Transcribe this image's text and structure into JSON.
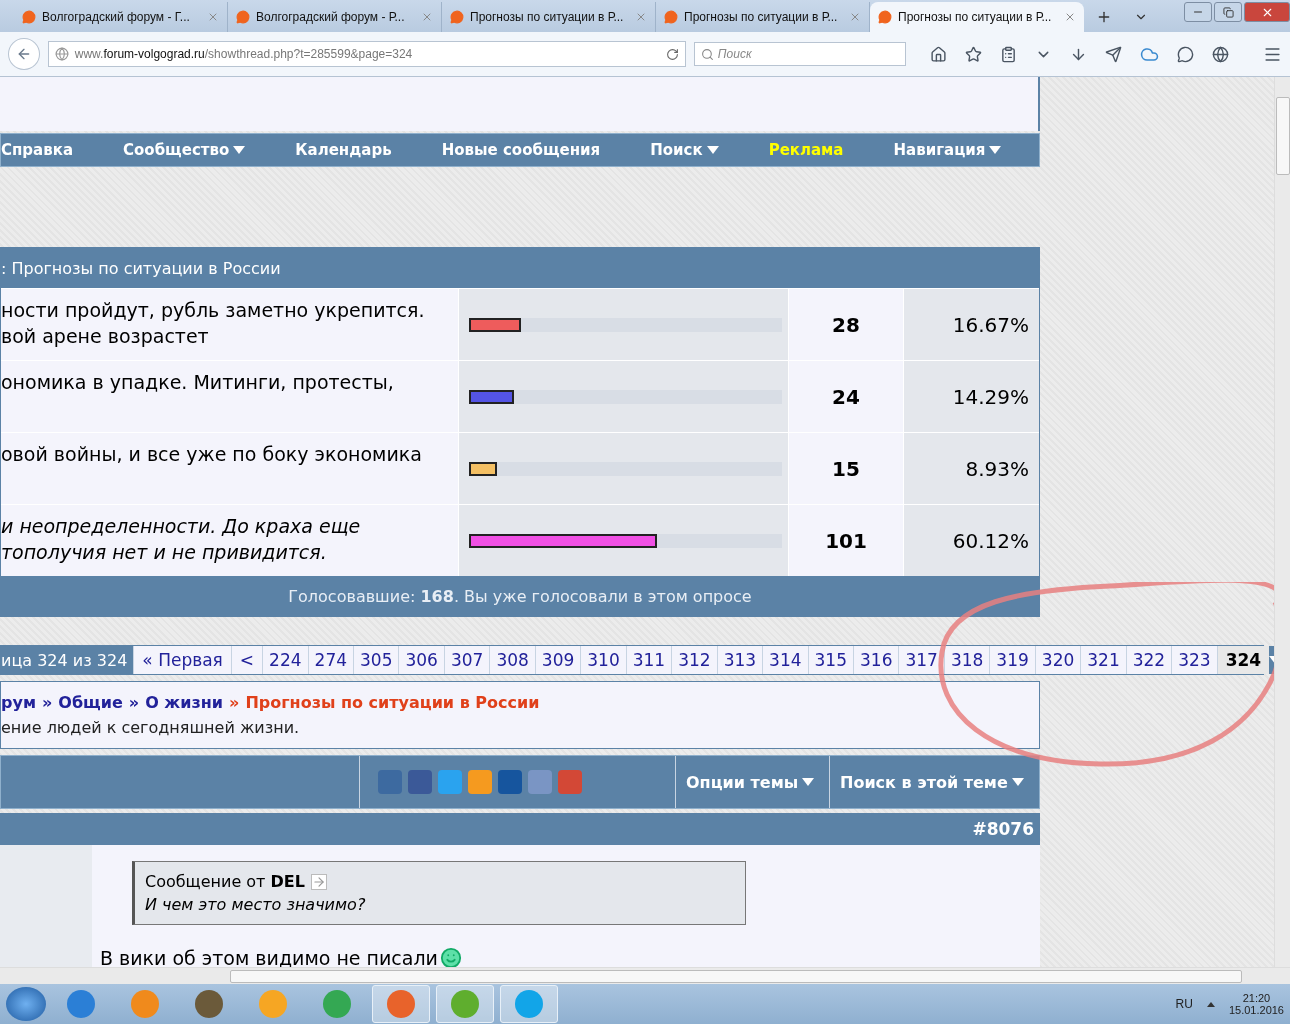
{
  "browser": {
    "tabs": [
      {
        "title": "Волгоградский форум - Г...",
        "selected": false
      },
      {
        "title": "Волгоградский форум - Р...",
        "selected": false
      },
      {
        "title": "Прогнозы по ситуации в Р...",
        "selected": false
      },
      {
        "title": "Прогнозы по ситуации в Р...",
        "selected": false
      },
      {
        "title": "Прогнозы по ситуации в Р...",
        "selected": true
      }
    ],
    "address": {
      "prefix": "www.",
      "domain": "forum-volgograd.ru",
      "path": "/showthread.php?t=285599&page=324"
    },
    "search": {
      "placeholder": "Поиск"
    }
  },
  "navbar": [
    {
      "label": "Справка",
      "dropdown": false,
      "highlight": false
    },
    {
      "label": "Сообщество",
      "dropdown": true,
      "highlight": false
    },
    {
      "label": "Календарь",
      "dropdown": false,
      "highlight": false
    },
    {
      "label": "Новые сообщения",
      "dropdown": false,
      "highlight": false
    },
    {
      "label": "Поиск",
      "dropdown": true,
      "highlight": false
    },
    {
      "label": "Реклама",
      "dropdown": false,
      "highlight": true
    },
    {
      "label": "Навигация",
      "dropdown": true,
      "highlight": false
    }
  ],
  "poll": {
    "title": ": Прогнозы по ситуации в России",
    "options": [
      {
        "lines": [
          "ности пройдут, рубль заметно укрепится.",
          "вой арене возрастет"
        ],
        "italic": false,
        "color": "#ee5c5c",
        "level": 0.1667,
        "votes": "28",
        "percent": "16.67%"
      },
      {
        "lines": [
          "ономика в упадке. Митинги, протесты,"
        ],
        "italic": false,
        "color": "#5454e4",
        "level": 0.1429,
        "votes": "24",
        "percent": "14.29%"
      },
      {
        "lines": [
          "овой войны, и все уже по боку экономика"
        ],
        "italic": false,
        "color": "#f4c064",
        "level": 0.0893,
        "votes": "15",
        "percent": "8.93%"
      },
      {
        "lines": [
          "и неопределенности. До краха еще",
          "тополучия нет и не привидится."
        ],
        "italic": true,
        "color": "#f050e4",
        "level": 0.6012,
        "votes": "101",
        "percent": "60.12%"
      }
    ],
    "footer": "Голосовавшие: **168**. Вы уже голосовали в этом опросе"
  },
  "pagination": {
    "label": "ица 324 из 324",
    "first": "« Первая",
    "prev": "<",
    "pages": [
      {
        "n": "224",
        "selected": false
      },
      {
        "n": "274",
        "selected": false
      },
      {
        "n": "305",
        "selected": false
      },
      {
        "n": "306",
        "selected": false
      },
      {
        "n": "307",
        "selected": false
      },
      {
        "n": "308",
        "selected": false
      },
      {
        "n": "309",
        "selected": false
      },
      {
        "n": "310",
        "selected": false
      },
      {
        "n": "311",
        "selected": false
      },
      {
        "n": "312",
        "selected": false
      },
      {
        "n": "313",
        "selected": false
      },
      {
        "n": "314",
        "selected": false
      },
      {
        "n": "315",
        "selected": false
      },
      {
        "n": "316",
        "selected": false
      },
      {
        "n": "317",
        "selected": false
      },
      {
        "n": "318",
        "selected": false
      },
      {
        "n": "319",
        "selected": false
      },
      {
        "n": "320",
        "selected": false
      },
      {
        "n": "321",
        "selected": false
      },
      {
        "n": "322",
        "selected": false
      },
      {
        "n": "323",
        "selected": false
      },
      {
        "n": "324",
        "selected": true
      }
    ]
  },
  "breadcrumb": {
    "links": [
      "рум",
      "Общие",
      "О жизни"
    ],
    "separator": "»",
    "current": "Прогнозы по ситуации в России",
    "description": "ение людей к сегодняшней жизни."
  },
  "thread_tools": {
    "share": [
      {
        "color": "#3d6aa0"
      },
      {
        "color": "#3b5998"
      },
      {
        "color": "#2aa3ef"
      },
      {
        "color": "#f59a1f"
      },
      {
        "color": "#16559e"
      },
      {
        "color": "#7a95c4"
      },
      {
        "color": "#d34836"
      }
    ],
    "buttons": [
      "Опции темы",
      "Поиск в этой теме"
    ]
  },
  "post": {
    "number": "#8076",
    "quote": {
      "from": "Сообщение от **DEL**",
      "text": "И чем это место значимо?"
    },
    "body": "В вики об этом видимо не писали"
  },
  "taskbar": {
    "apps": [
      {
        "color": "#2b7fd6",
        "selected": false
      },
      {
        "color": "#f08a1c",
        "selected": false
      },
      {
        "color": "#6b5a3a",
        "selected": false
      },
      {
        "color": "#f6a623",
        "selected": false
      },
      {
        "color": "#34a853",
        "selected": false
      },
      {
        "color": "#e8632b",
        "selected": true
      },
      {
        "color": "#5fae2e",
        "selected": true
      },
      {
        "color": "#12a5e8",
        "selected": true
      }
    ],
    "language": "RU",
    "time": "21:20",
    "date": "15.01.2016"
  }
}
